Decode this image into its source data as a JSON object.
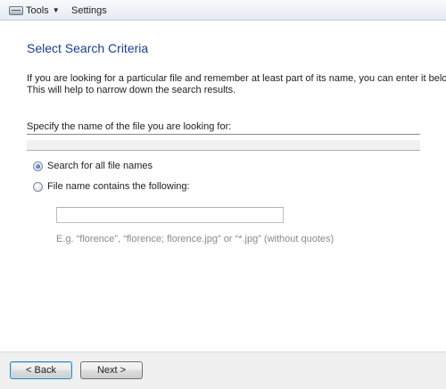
{
  "menubar": {
    "tools_label": "Tools",
    "settings_label": "Settings"
  },
  "main": {
    "title": "Select Search Criteria",
    "intro_line1": "If you are looking for a particular file and remember at least part of its name, you can enter it below.",
    "intro_line2": "This will help to narrow down the search results.",
    "specify_label": "Specify the name of the file you are looking for:",
    "options": [
      {
        "label": "Search for all file names",
        "selected": true
      },
      {
        "label": "File name contains the following:",
        "selected": false
      }
    ],
    "contains_value": "",
    "example_text": "E.g. “florence”, “florence; florence.jpg” or “*.jpg” (without quotes)"
  },
  "footer": {
    "back_label": "< Back",
    "next_label": "Next >"
  }
}
